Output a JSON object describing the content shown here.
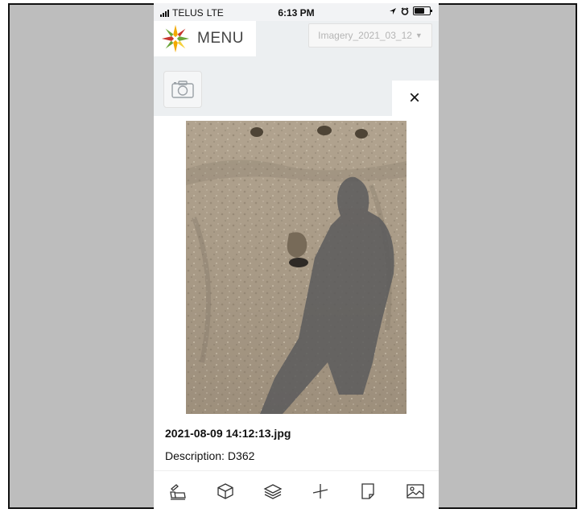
{
  "status": {
    "carrier": "TELUS",
    "network": "LTE",
    "time": "6:13 PM"
  },
  "header": {
    "menu_label": "MENU",
    "imagery_select": "Imagery_2021_03_12"
  },
  "photo": {
    "filename": "2021-08-09 14:12:13.jpg",
    "description_label": "Description:",
    "description_value": "D362"
  },
  "close_glyph": "×",
  "toolbar": {
    "items": [
      {
        "name": "map-drawing-icon"
      },
      {
        "name": "3d-box-icon"
      },
      {
        "name": "layers-icon"
      },
      {
        "name": "measure-icon"
      },
      {
        "name": "page-icon"
      },
      {
        "name": "image-icon"
      }
    ]
  },
  "colors": {
    "background": "#bdbdbd",
    "app_bg": "#eceff1",
    "logo_colors": [
      "#f2a900",
      "#6ba539",
      "#c7352d",
      "#f6d13b"
    ]
  }
}
